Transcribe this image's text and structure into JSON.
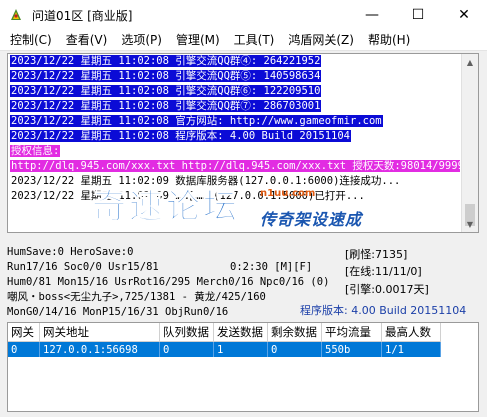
{
  "window": {
    "title": "问道01区 [商业版]",
    "controls": {
      "minimize": "—",
      "maximize": "☐",
      "close": "✕"
    }
  },
  "menu": [
    "控制(C)",
    "查看(V)",
    "选项(P)",
    "管理(M)",
    "工具(T)",
    "鸿盾网关(Z)",
    "帮助(H)"
  ],
  "log": {
    "lines": [
      {
        "text": "2023/12/22 星期五 11:02:08 引擎交流QQ群④: 264221952",
        "style": "blue"
      },
      {
        "text": "2023/12/22 星期五 11:02:08 引擎交流QQ群⑤: 140598634",
        "style": "blue"
      },
      {
        "text": "2023/12/22 星期五 11:02:08 引擎交流QQ群⑥: 122209510",
        "style": "blue"
      },
      {
        "text": "2023/12/22 星期五 11:02:08 引擎交流QQ群⑦: 286703001",
        "style": "blue"
      },
      {
        "text": "2023/12/22 星期五 11:02:08 官方网站: http://www.gameofmir.com",
        "style": "blue"
      },
      {
        "text": "2023/12/22 星期五 11:02:08 程序版本: 4.00 Build 20151104",
        "style": "blue"
      },
      {
        "text": "授权信息:",
        "style": "magenta"
      },
      {
        "text": "http://dlq.945.com/xxx.txt http://dlq.945.com/xxx.txt 授权天数:98014/99999",
        "style": "magenta"
      },
      {
        "text": "2023/12/22 星期五 11:02:09 数据库服务器(127.0.0.1:6000)连接成功...",
        "style": "plain"
      },
      {
        "text": "2023/12/22 星期五 11:02:09 ……[……](127.0.0.1:5000)已打开...",
        "style": "plain"
      }
    ]
  },
  "watermark": {
    "main": "奇速论坛",
    "url": "n1uu.com",
    "sub": "传奇架设速成"
  },
  "status": {
    "line1": "HumSave:0 HeroSave:0",
    "line2": "Run17/16 Soc0/0 Usr15/81",
    "line2_right": "0:2:30 [M][F]",
    "line3": "Hum0/81 Mon15/16 UsrRot16/295 Merch0/16 Npc0/16 (0)",
    "line4": "嘲风・boss<无尘九子>,725/1381 - 黄龙/425/160",
    "line5": "MonG0/14/16 MonP15/16/31 ObjRun0/16",
    "counter1": "[刷怪:7135]",
    "counter2": "[在线:11/11/0]",
    "counter3": "[引擎:0.0017天]",
    "version": "程序版本: 4.00 Build 20151104"
  },
  "gateway_table": {
    "headers": [
      "网关",
      "网关地址",
      "队列数据",
      "发送数据",
      "剩余数据",
      "平均流量",
      "最高人数"
    ],
    "rows": [
      [
        "0",
        "127.0.0.1:56698",
        "0",
        "1",
        "0",
        "550b",
        "1/1"
      ]
    ]
  }
}
